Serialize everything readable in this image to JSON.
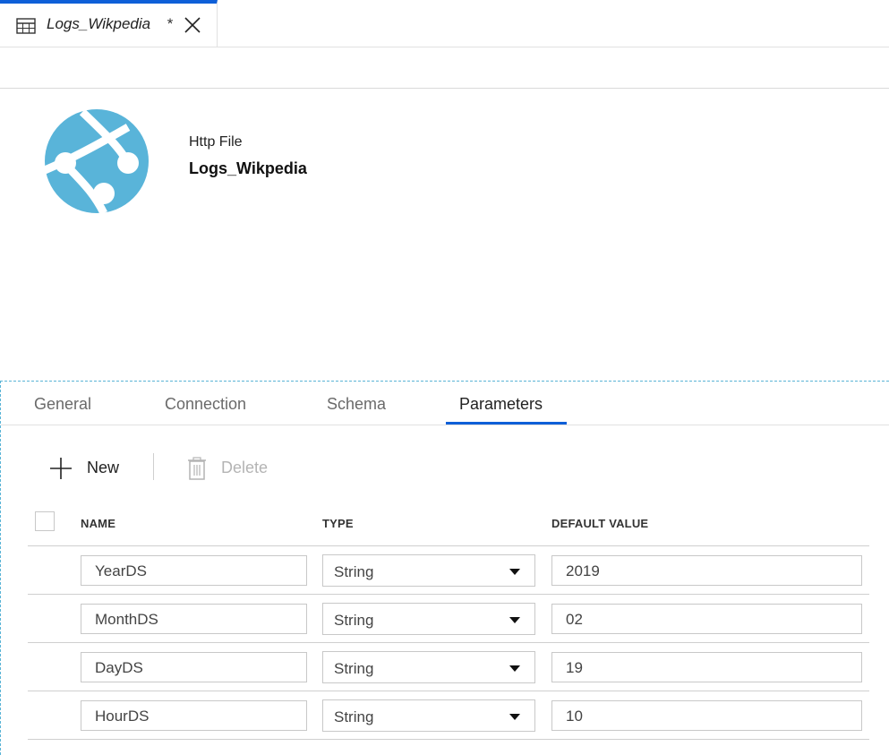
{
  "document_tab": {
    "title": "Logs_Wikpedia",
    "dirty_marker": "*",
    "icon": "table-icon",
    "close_icon": "close-icon"
  },
  "dataset": {
    "icon": "http-web-icon",
    "icon_color": "#59b4d9",
    "type": "Http File",
    "name": "Logs_Wikpedia"
  },
  "property_tabs": [
    {
      "label": "General",
      "active": false
    },
    {
      "label": "Connection",
      "active": false
    },
    {
      "label": "Schema",
      "active": false
    },
    {
      "label": "Parameters",
      "active": true
    }
  ],
  "toolbar": {
    "new_label": "New",
    "delete_label": "Delete",
    "delete_enabled": false
  },
  "table": {
    "columns": [
      "NAME",
      "TYPE",
      "DEFAULT VALUE"
    ],
    "rows": [
      {
        "name": "YearDS",
        "type": "String",
        "default": "2019"
      },
      {
        "name": "MonthDS",
        "type": "String",
        "default": "02"
      },
      {
        "name": "DayDS",
        "type": "String",
        "default": "19"
      },
      {
        "name": "HourDS",
        "type": "String",
        "default": "10"
      }
    ]
  },
  "colors": {
    "accent": "#0e5fd8",
    "panel_border": "#5ab4d6"
  }
}
